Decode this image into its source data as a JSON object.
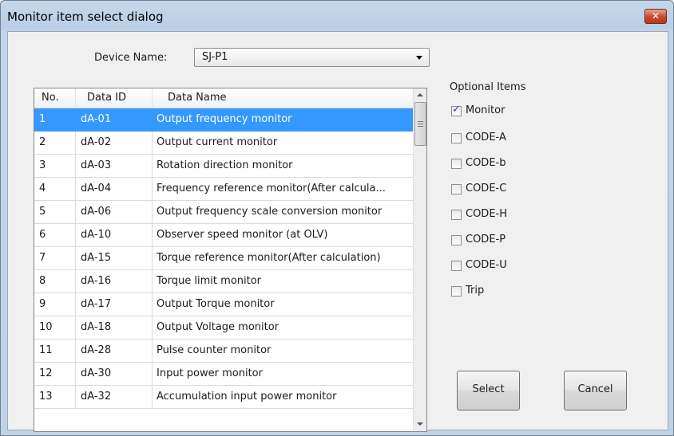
{
  "window": {
    "title": "Monitor item select dialog",
    "close_glyph": "✕"
  },
  "device": {
    "label": "Device Name:",
    "value": "SJ-P1"
  },
  "table": {
    "headers": [
      "No.",
      "Data ID",
      "Data Name"
    ],
    "rows": [
      [
        "1",
        "dA-01",
        "Output frequency monitor"
      ],
      [
        "2",
        "dA-02",
        "Output current monitor"
      ],
      [
        "3",
        "dA-03",
        "Rotation direction monitor"
      ],
      [
        "4",
        "dA-04",
        "Frequency reference monitor(After calcula..."
      ],
      [
        "5",
        "dA-06",
        "Output frequency scale conversion monitor"
      ],
      [
        "6",
        "dA-10",
        "Observer speed monitor (at OLV)"
      ],
      [
        "7",
        "dA-15",
        "Torque reference monitor(After calculation)"
      ],
      [
        "8",
        "dA-16",
        "Torque limit monitor"
      ],
      [
        "9",
        "dA-17",
        "Output Torque monitor"
      ],
      [
        "10",
        "dA-18",
        "Output Voltage monitor"
      ],
      [
        "11",
        "dA-28",
        "Pulse counter monitor"
      ],
      [
        "12",
        "dA-30",
        "Input power monitor"
      ],
      [
        "13",
        "dA-32",
        "Accumulation input power monitor"
      ]
    ],
    "selected_row": 0
  },
  "options": {
    "title": "Optional Items",
    "items": [
      {
        "label": "Monitor",
        "checked": true
      },
      {
        "label": "CODE-A",
        "checked": false
      },
      {
        "label": "CODE-b",
        "checked": false
      },
      {
        "label": "CODE-C",
        "checked": false
      },
      {
        "label": "CODE-H",
        "checked": false
      },
      {
        "label": "CODE-P",
        "checked": false
      },
      {
        "label": "CODE-U",
        "checked": false
      },
      {
        "label": "Trip",
        "checked": false
      }
    ]
  },
  "buttons": {
    "select": "Select",
    "cancel": "Cancel"
  },
  "colors": {
    "selection": "#3399ff",
    "titlebar": "#b9cfe6",
    "close": "#c7482b"
  }
}
